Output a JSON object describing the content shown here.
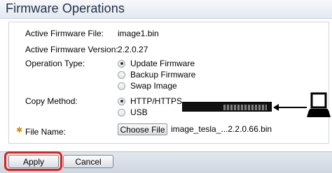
{
  "page": {
    "title": "Firmware Operations"
  },
  "fields": {
    "active_firmware_file": {
      "label": "Active Firmware File:",
      "value": "image1.bin"
    },
    "active_firmware_version": {
      "label": "Active Firmware Version:",
      "value": "2.2.0.27"
    },
    "operation_type": {
      "label": "Operation Type:",
      "options": [
        {
          "label": "Update Firmware",
          "selected": true
        },
        {
          "label": "Backup Firmware",
          "selected": false
        },
        {
          "label": "Swap Image",
          "selected": false
        }
      ]
    },
    "copy_method": {
      "label": "Copy Method:",
      "options": [
        {
          "label": "HTTP/HTTPS",
          "selected": true
        },
        {
          "label": "USB",
          "selected": false
        }
      ]
    },
    "file_name": {
      "label": "File Name:",
      "button_label": "Choose File",
      "value": "image_tesla_...2.2.0.66.bin",
      "required_icon": "asterisk-icon"
    }
  },
  "illustration": {
    "device_icon": "network-switch-icon",
    "arrow_icon": "arrow-left-icon",
    "computer_icon": "laptop-icon"
  },
  "actions": {
    "apply_label": "Apply",
    "cancel_label": "Cancel",
    "highlight_color": "#e32119"
  }
}
